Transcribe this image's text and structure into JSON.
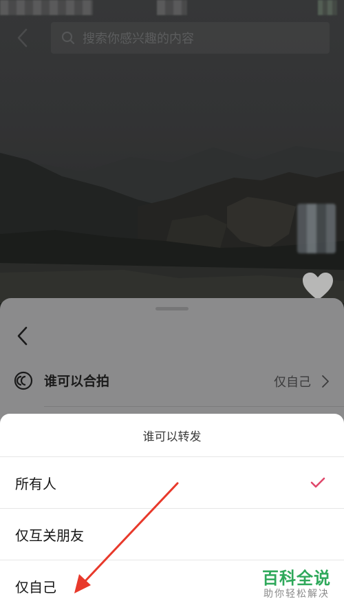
{
  "top_bar": {
    "search_placeholder": "搜索你感兴趣的内容"
  },
  "settings_sheet": {
    "row_label": "谁可以合拍",
    "row_value": "仅自己"
  },
  "action_sheet": {
    "title": "谁可以转发",
    "options": [
      {
        "label": "所有人",
        "selected": true
      },
      {
        "label": "仅互关朋友",
        "selected": false
      },
      {
        "label": "仅自己",
        "selected": false
      }
    ]
  },
  "watermark": {
    "main": "百科全说",
    "sub": "助你轻松解决"
  },
  "colors": {
    "check_accent": "#e0476a",
    "annotation_arrow": "#e8392b",
    "watermark_green": "#2ea85a"
  },
  "icons": [
    "back-arrow-icon",
    "search-icon",
    "heart-icon",
    "duet-icon",
    "chevron-right-icon",
    "check-icon",
    "annotation-arrow"
  ]
}
